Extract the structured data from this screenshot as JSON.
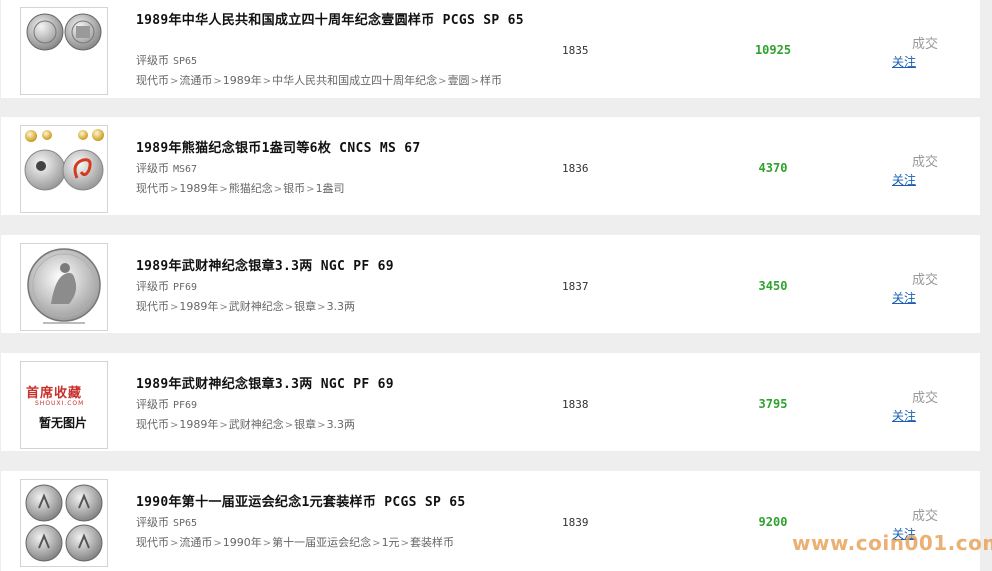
{
  "lots": [
    {
      "title": "1989年中华人民共和国成立四十周年纪念壹圆样币 PCGS SP 65",
      "grade_label": "评级币",
      "grade": "SP65",
      "path": [
        "现代币",
        "流通币",
        "1989年",
        "中华人民共和国成立四十周年纪念",
        "壹圆",
        "样币"
      ],
      "lot_no": "1835",
      "price": "10925",
      "status": "成交",
      "follow": "关注",
      "thumb": "two-coin-icon"
    },
    {
      "title": "1989年熊猫纪念银币1盎司等6枚 CNCS MS 67",
      "grade_label": "评级币",
      "grade": "MS67",
      "path": [
        "现代币",
        "1989年",
        "熊猫纪念",
        "银币",
        "1盎司"
      ],
      "lot_no": "1836",
      "price": "4370",
      "status": "成交",
      "follow": "关注",
      "thumb": "coin-set-icon"
    },
    {
      "title": "1989年武财神纪念银章3.3两 NGC PF 69",
      "grade_label": "评级币",
      "grade": "PF69",
      "path": [
        "现代币",
        "1989年",
        "武财神纪念",
        "银章",
        "3.3两"
      ],
      "lot_no": "1837",
      "price": "3450",
      "status": "成交",
      "follow": "关注",
      "thumb": "silver-medal-icon"
    },
    {
      "title": "1989年武财神纪念银章3.3两 NGC PF 69",
      "grade_label": "评级币",
      "grade": "PF69",
      "path": [
        "现代币",
        "1989年",
        "武财神纪念",
        "银章",
        "3.3两"
      ],
      "lot_no": "1838",
      "price": "3795",
      "status": "成交",
      "follow": "关注",
      "thumb": "no-image-placeholder"
    },
    {
      "title": "1990年第十一届亚运会纪念1元套装样币 PCGS SP 65",
      "grade_label": "评级币",
      "grade": "SP65",
      "path": [
        "现代币",
        "流通币",
        "1990年",
        "第十一届亚运会纪念",
        "1元",
        "套装样币"
      ],
      "lot_no": "1839",
      "price": "9200",
      "status": "成交",
      "follow": "关注",
      "thumb": "four-coin-icon"
    }
  ],
  "placeholder": {
    "logo_cn": "首席收藏",
    "logo_en": "SHOUXI.COM",
    "text": "暂无图片"
  },
  "watermark": "www.coin001.com",
  "colors": {
    "price": "#2fa22f",
    "follow_link": "#1a5fb4",
    "status": "#999999",
    "background": "#eeeeee"
  }
}
